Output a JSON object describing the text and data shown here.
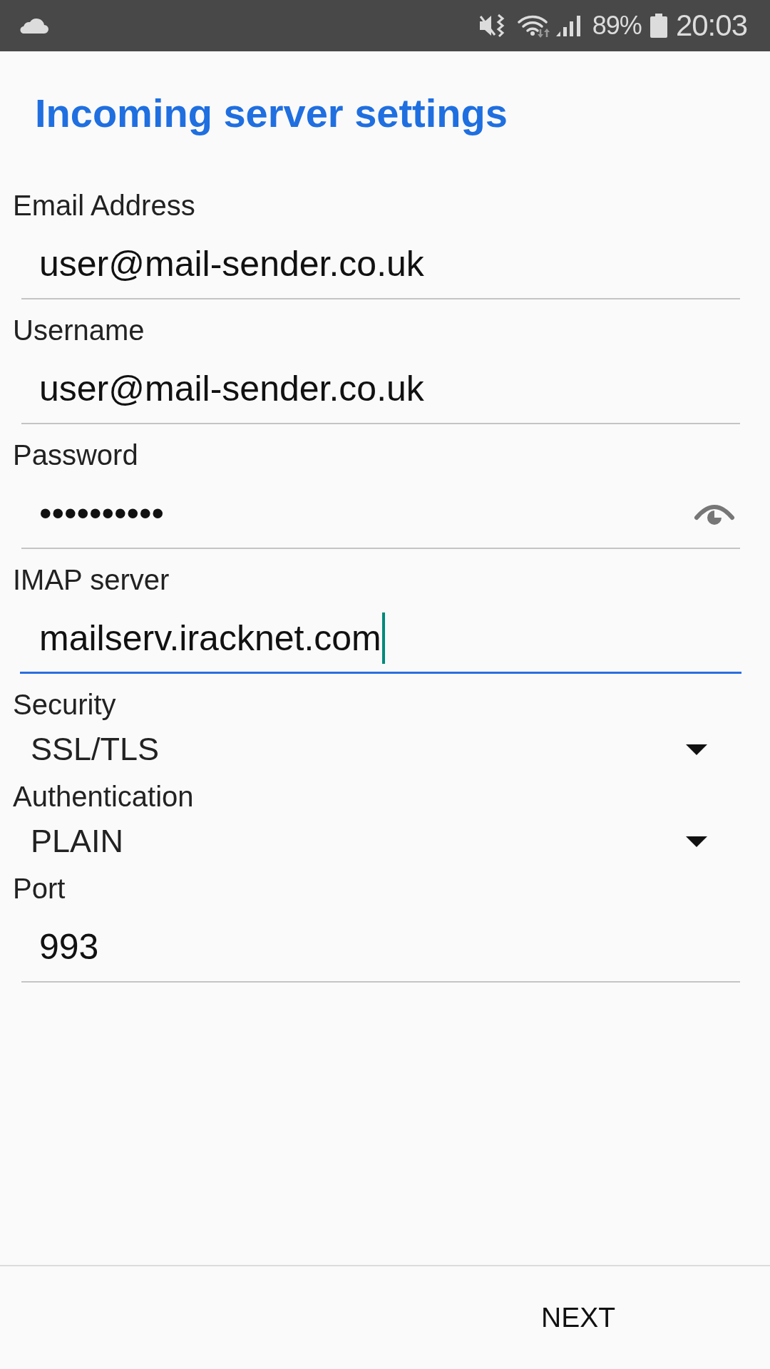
{
  "status_bar": {
    "battery_text": "89%",
    "time": "20:03"
  },
  "header": {
    "title": "Incoming server settings"
  },
  "fields": [
    {
      "kind": "text",
      "label": "Email Address",
      "value": "user@mail-sender.co.uk",
      "focused": false
    },
    {
      "kind": "text",
      "label": "Username",
      "value": "user@mail-sender.co.uk",
      "focused": false
    },
    {
      "kind": "password",
      "label": "Password",
      "value": "••••••••••",
      "focused": false
    },
    {
      "kind": "text",
      "label": "IMAP server",
      "value": "mailserv.iracknet.com",
      "focused": true
    },
    {
      "kind": "dropdown",
      "label": "Security",
      "value": "SSL/TLS"
    },
    {
      "kind": "dropdown",
      "label": "Authentication",
      "value": "PLAIN"
    },
    {
      "kind": "text",
      "label": "Port",
      "value": "993",
      "focused": false
    }
  ],
  "footer": {
    "button": "NEXT"
  }
}
